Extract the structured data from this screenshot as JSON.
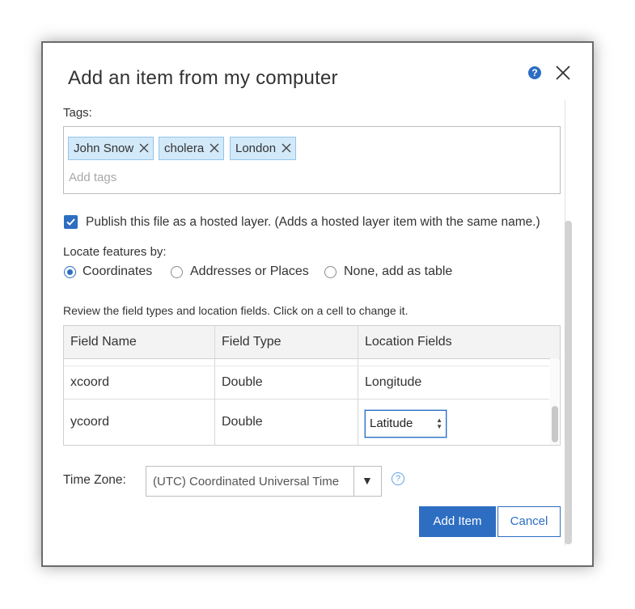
{
  "dialog": {
    "title": "Add an item from my computer",
    "help_icon": "question-circle-icon",
    "close_icon": "close-x-icon"
  },
  "tags": {
    "label": "Tags:",
    "chips": [
      "John Snow",
      "cholera",
      "London"
    ],
    "placeholder": "Add tags"
  },
  "publish": {
    "checked": true,
    "label": "Publish this file as a hosted layer. (Adds a hosted layer item with the same name.)"
  },
  "locate": {
    "label": "Locate features by:",
    "options": [
      "Coordinates",
      "Addresses or Places",
      "None, add as table"
    ],
    "selected": "Coordinates"
  },
  "fields": {
    "instruction": "Review the field types and location fields. Click on a cell to change it.",
    "columns": [
      "Field Name",
      "Field Type",
      "Location Fields"
    ],
    "rows": [
      {
        "name": "xcoord",
        "type": "Double",
        "location": "Longitude"
      },
      {
        "name": "ycoord",
        "type": "Double",
        "location": "Latitude"
      }
    ]
  },
  "time_zone": {
    "label": "Time Zone:",
    "value": "(UTC) Coordinated Universal Time",
    "arrow": "▼"
  },
  "buttons": {
    "add_item": "Add Item",
    "cancel": "Cancel"
  },
  "colors": {
    "accent": "#2d6ec2",
    "chip_bg": "#d2e9f9",
    "chip_border": "#93c5ea"
  }
}
